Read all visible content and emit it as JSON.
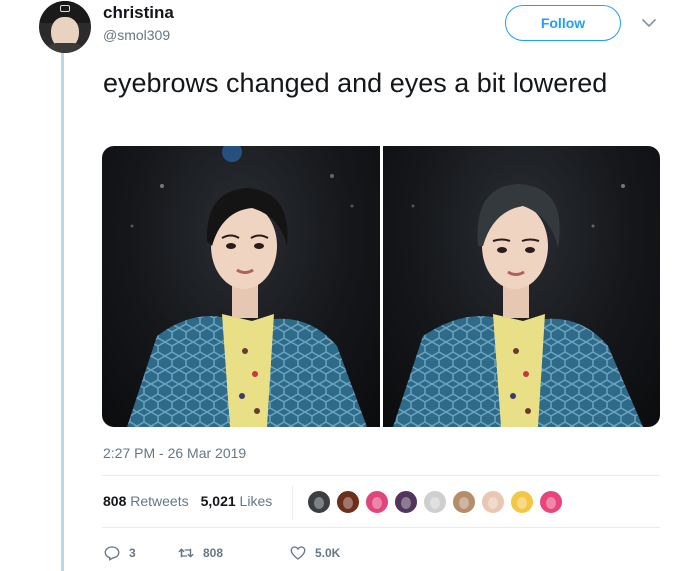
{
  "user": {
    "name": "christina",
    "handle": "@smol309"
  },
  "header": {
    "follow_label": "Follow"
  },
  "tweet": {
    "text": "eyebrows changed and eyes a bit lowered",
    "timestamp": "2:27 PM - 26 Mar 2019"
  },
  "media": {
    "images": [
      {
        "alt_name": "doll-photo-left"
      },
      {
        "alt_name": "doll-photo-right"
      }
    ]
  },
  "stats": {
    "retweets_count": "808",
    "retweets_label": "Retweets",
    "likes_count": "5,021",
    "likes_label": "Likes"
  },
  "likers": [
    {
      "color": "#3b3f44"
    },
    {
      "color": "#6b2f1c"
    },
    {
      "color": "#e0457b"
    },
    {
      "color": "#51355a"
    },
    {
      "color": "#cfcfcf"
    },
    {
      "color": "#b48e6a"
    },
    {
      "color": "#e9c7b3"
    },
    {
      "color": "#f3c744"
    },
    {
      "color": "#e8457c"
    }
  ],
  "actions": {
    "replies": "3",
    "retweets": "808",
    "likes": "5.0K"
  },
  "colors": {
    "accent": "#1da1f2",
    "thread_line": "#b9d7ea",
    "secondary_text": "#657786"
  }
}
